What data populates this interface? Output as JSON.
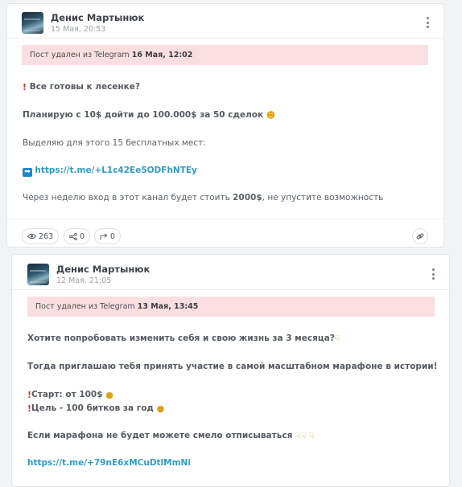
{
  "posts": [
    {
      "author": "Денис Мартынюк",
      "date": "15 Мая, 20:53",
      "deleted_prefix": "Пост удален из Telegram",
      "deleted_date": "16 Мая, 12:02",
      "lines": {
        "l1": "Все готовы к лесенке?",
        "l2": "Планирую с 10$ дойти до 100.000$ за 50 сделок",
        "l3": "Выделяю для этого 15 бесплатных мест:",
        "l4_link": "https://t.me/+L1c42Ee5ODFhNTEy",
        "l5_pre": "Через неделю вход в этот канал будет стоить ",
        "l5_bold": "2000$",
        "l5_post": ", не упустите возможность"
      },
      "stats": {
        "views": "263",
        "shares": "0",
        "forwards": "0"
      }
    },
    {
      "author": "Денис Мартынюк",
      "date": "12 Мая, 21:05",
      "deleted_prefix": "Пост удален из Telegram",
      "deleted_date": "13 Мая, 13:45",
      "lines": {
        "l1": "Хотите попробовать изменить себя и свою жизнь за 3 месяца?",
        "l2": "Тогда приглашаю тебя принять участие в самой масштабном марафоне в истории!",
        "l3": "Старт: от 100$",
        "l4": "Цель - 100 битков за год",
        "l5": "Если марафона не будет можете смело отписываться",
        "l6_link": "https://t.me/+79nE6xMCuDtlMmNi"
      }
    }
  ],
  "icons": {
    "views": "eye-icon",
    "shares": "share-icon",
    "forwards": "forward-icon",
    "link": "link-icon",
    "menu": "more-vertical-icon"
  },
  "colors": {
    "deleted_bg": "#fbdfe0",
    "link": "#2e9bc9"
  }
}
